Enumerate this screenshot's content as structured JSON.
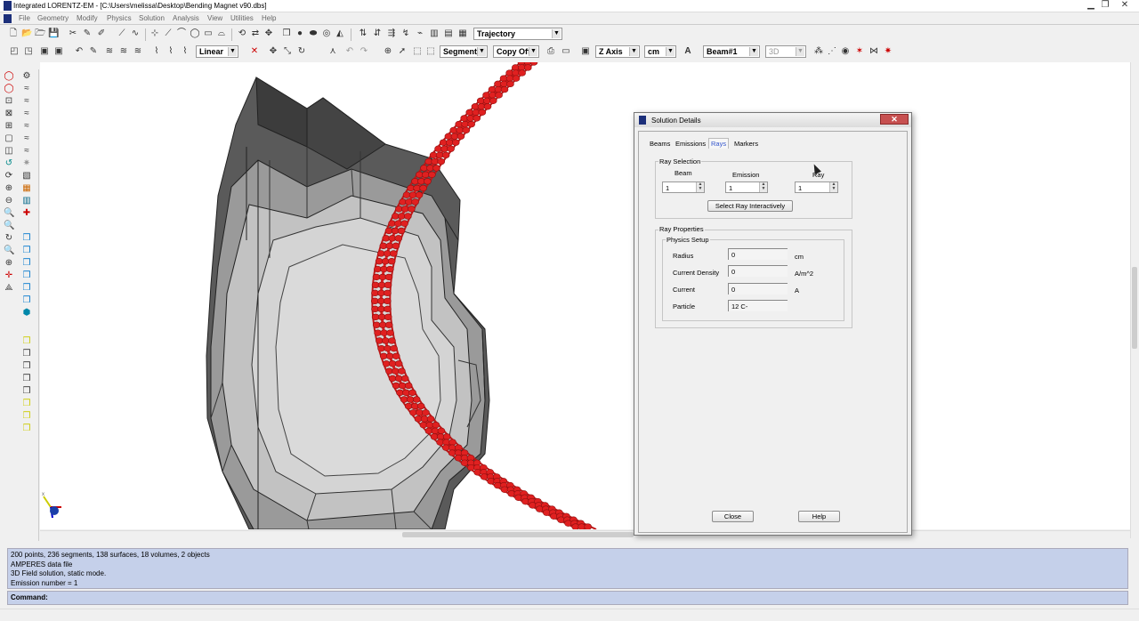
{
  "window": {
    "title": "Integrated LORENTZ-EM - [C:\\Users\\melissa\\Desktop\\Bending Magnet v90.dbs]"
  },
  "menu": [
    "File",
    "Geometry",
    "Modify",
    "Physics",
    "Solution",
    "Analysis",
    "View",
    "Utilities",
    "Help"
  ],
  "toolbar1": {
    "view_select": "Trajectory"
  },
  "toolbar2": {
    "interp": "Linear",
    "segment": "Segment",
    "copy": "Copy Off",
    "axis": "Z Axis",
    "units": "cm",
    "beam": "Beam#1",
    "view3d": "3D"
  },
  "console": {
    "lines": [
      "200 points,    236 segments,    138 surfaces,    18 volumes,    2 objects",
      "AMPERES data file",
      "3D Field solution, static mode.",
      "Emission number = 1"
    ],
    "command_label": "Command:"
  },
  "dialog": {
    "title": "Solution Details",
    "close_x": "✕",
    "tabs": [
      "Beams",
      "Emissions",
      "Rays",
      "Markers"
    ],
    "active_tab": "Rays",
    "ray_selection": {
      "title": "Ray Selection",
      "beam_label": "Beam",
      "beam_value": "1",
      "emission_label": "Emission",
      "emission_value": "1",
      "ray_label": "Ray",
      "ray_value": "1",
      "select_button": "Select Ray Interactively"
    },
    "ray_properties": {
      "title": "Ray Properties",
      "physics_setup": "Physics Setup",
      "radius_label": "Radius",
      "radius_value": "0",
      "radius_unit": "cm",
      "current_density_label": "Current Density",
      "current_density_value": "0",
      "current_density_unit": "A/m^2",
      "current_label": "Current",
      "current_value": "0",
      "current_unit": "A",
      "particle_label": "Particle",
      "particle_value": "12 C-"
    },
    "close_button": "Close",
    "help_button": "Help"
  },
  "colors": {
    "beam": "#e02020",
    "console_bg": "#c5d0ea",
    "active_tab": "#3355cc"
  }
}
